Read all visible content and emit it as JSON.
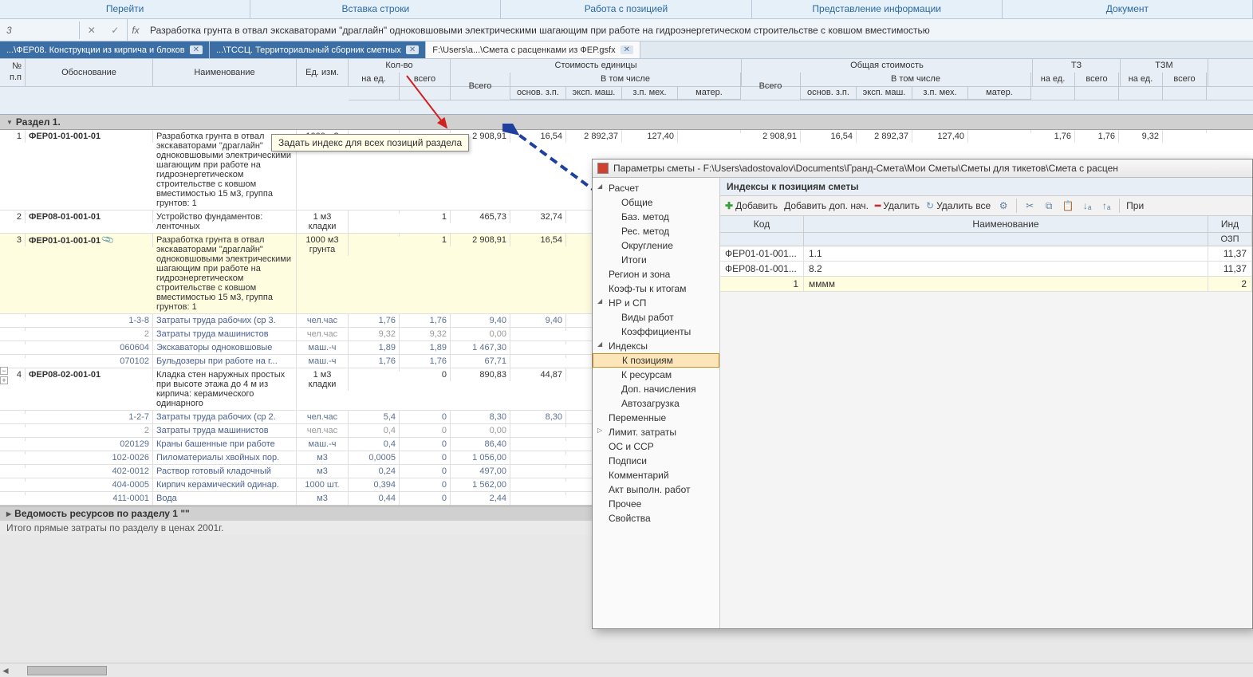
{
  "menu": {
    "items": [
      "Перейти",
      "Вставка строки",
      "Работа с позицией",
      "Представление информации",
      "Документ"
    ]
  },
  "formula_bar": {
    "cell_ref": "3",
    "fx_label": "fx",
    "text": "Разработка грунта в отвал экскаваторами \"драглайн\" одноковшовыми электрическими шагающим при работе на гидроэнергетическом строительстве с ковшом вместимостью"
  },
  "tabs": [
    {
      "label": "...\\ФЕР08. Конструкции из кирпича и блоков",
      "active": false
    },
    {
      "label": "...\\ТССЦ. Территориальный сборник сметных",
      "active": false
    },
    {
      "label": "F:\\Users\\а...\\Смета с расценками из ФЕР.gsfx",
      "active": true
    }
  ],
  "grid_headers": {
    "r1": {
      "pp": "№\nп.п",
      "osn": "Обоснование",
      "name": "Наименование",
      "ed": "Ед. изм.",
      "kol": "Кол-во",
      "se": "Стоимость единицы",
      "os": "Общая стоимость",
      "tz": "ТЗ",
      "tzm": "ТЗМ"
    },
    "r2": {
      "q1": "на ед.",
      "q2": "всего",
      "v1": "Всего",
      "vt": "В том числе",
      "vsego2": "Всего",
      "vt2": "В том числе",
      "ned": "на ед.",
      "vseg": "всего",
      "ned2": "на ед.",
      "vseg2": "всего"
    },
    "r3": {
      "ozp": "основ. з.п.",
      "em": "эксп. маш.",
      "zpm": "з.п. мех.",
      "mat": "матер.",
      "ozp2": "основ. з.п.",
      "em2": "эксп. маш.",
      "zpm2": "з.п. мех.",
      "mat2": "матер."
    }
  },
  "section_header": "Раздел 1.",
  "tooltip": "Задать индекс для всех позиций раздела",
  "rows": [
    {
      "type": "main",
      "pp": "1",
      "osn": "ФЕР01-01-001-01",
      "name": "Разработка грунта в отвал экскаваторами \"драглайн\" одноковшовыми электрическими шагающим при работе на гидроэнергетическом строительстве с ковшом вместимостью 15 м3, группа грунтов: 1",
      "ed": "1000 м3",
      "q1": "",
      "q2": "",
      "vsego": "2 908,91",
      "ozp": "16,54",
      "em": "2 892,37",
      "zpm": "127,40",
      "mat": "",
      "vsego2": "2 908,91",
      "ozp2": "16,54",
      "em2": "2 892,37",
      "zpm2": "127,40",
      "mat2": "",
      "tz1": "1,76",
      "tz2": "1,76",
      "tzm1": "9,32",
      "tzm2": ""
    },
    {
      "type": "main",
      "pp": "2",
      "osn": "ФЕР08-01-001-01",
      "name": "Устройство фундаментов: ленточных",
      "ed": "1 м3 кладки",
      "q1": "",
      "q2": "1",
      "vsego": "465,73",
      "ozp": "32,74",
      "em": "",
      "zpm": "",
      "mat": "",
      "vsego2": "",
      "ozp2": "",
      "em2": "",
      "zpm2": "",
      "mat2": "",
      "tz1": "",
      "tz2": "",
      "tzm1": "",
      "tzm2": ""
    },
    {
      "type": "main",
      "hl": true,
      "pp": "3",
      "osn": "ФЕР01-01-001-01",
      "clip": true,
      "name": "Разработка грунта в отвал экскаваторами \"драглайн\" одноковшовыми электрическими шагающим при работе на гидроэнергетическом строительстве с ковшом вместимостью 15 м3, группа грунтов: 1",
      "ed": "1000 м3 грунта",
      "q1": "",
      "q2": "1",
      "vsego": "2 908,91",
      "ozp": "16,54",
      "em": "",
      "zpm": "",
      "mat": "",
      "vsego2": "",
      "ozp2": "",
      "em2": "",
      "zpm2": "",
      "mat2": "",
      "tz1": "",
      "tz2": "",
      "tzm1": "",
      "tzm2": ""
    },
    {
      "type": "sub",
      "osn": "1-3-8",
      "name": "Затраты труда рабочих (ср 3.",
      "ed": "чел.час",
      "q1": "1,76",
      "q2": "1,76",
      "vsego": "9,40",
      "ozp": "9,40"
    },
    {
      "type": "sub",
      "grey": true,
      "osn": "2",
      "name": "Затраты труда машинистов",
      "ed": "чел.час",
      "q1": "9,32",
      "q2": "9,32",
      "vsego": "0,00",
      "ozp": ""
    },
    {
      "type": "sub",
      "osn": "060604",
      "name": "Экскаваторы одноковшовые ",
      "ed": "маш.-ч",
      "q1": "1,89",
      "q2": "1,89",
      "vsego": "1 467,30",
      "ozp": ""
    },
    {
      "type": "sub",
      "osn": "070102",
      "name": "Бульдозеры при работе на г...",
      "ed": "маш.-ч",
      "q1": "1,76",
      "q2": "1,76",
      "vsego": "67,71",
      "ozp": ""
    },
    {
      "type": "main",
      "pp": "4",
      "osn": "ФЕР08-02-001-01",
      "name": "Кладка стен наружных простых при высоте этажа до 4 м из кирпича: керамического одинарного",
      "ed": "1 м3 кладки",
      "q1": "",
      "q2": "0",
      "vsego": "890,83",
      "ozp": "44,87",
      "em": "",
      "zpm": "",
      "mat": "",
      "vsego2": "",
      "ozp2": "",
      "em2": "",
      "zpm2": "",
      "mat2": "",
      "tz1": "",
      "tz2": "",
      "tzm1": "",
      "tzm2": ""
    },
    {
      "type": "sub",
      "osn": "1-2-7",
      "name": "Затраты труда рабочих (ср 2.",
      "ed": "чел.час",
      "q1": "5,4",
      "q2": "0",
      "vsego": "8,30",
      "ozp": "8,30"
    },
    {
      "type": "sub",
      "grey": true,
      "osn": "2",
      "name": "Затраты труда машинистов",
      "ed": "чел.час",
      "q1": "0,4",
      "q2": "0",
      "vsego": "0,00",
      "ozp": ""
    },
    {
      "type": "sub",
      "osn": "020129",
      "name": "Краны башенные при работе",
      "ed": "маш.-ч",
      "q1": "0,4",
      "q2": "0",
      "vsego": "86,40",
      "ozp": ""
    },
    {
      "type": "sub",
      "osn": "102-0026",
      "name": "Пиломатериалы хвойных пор.",
      "ed": "м3",
      "q1": "0,0005",
      "q2": "0",
      "vsego": "1 056,00",
      "ozp": ""
    },
    {
      "type": "sub",
      "osn": "402-0012",
      "name": "Раствор готовый кладочный ",
      "ed": "м3",
      "q1": "0,24",
      "q2": "0",
      "vsego": "497,00",
      "ozp": ""
    },
    {
      "type": "sub",
      "osn": "404-0005",
      "name": "Кирпич керамический одинар.",
      "ed": "1000 шт.",
      "q1": "0,394",
      "q2": "0",
      "vsego": "1 562,00",
      "ozp": ""
    },
    {
      "type": "sub",
      "osn": "411-0001",
      "name": "Вода",
      "ed": "м3",
      "q1": "0,44",
      "q2": "0",
      "vsego": "2,44",
      "ozp": ""
    }
  ],
  "footer_section": "Ведомость ресурсов по разделу 1 \"\"",
  "totals_text": "Итого прямые затраты по разделу в ценах 2001г.",
  "float_win": {
    "title": "Параметры сметы - F:\\Users\\adostovalov\\Documents\\Гранд-Смета\\Мои Сметы\\Сметы для тикетов\\Смета с расцен",
    "tree": [
      {
        "label": "Расчет",
        "toggle": true,
        "l": 1
      },
      {
        "label": "Общие",
        "l": 2
      },
      {
        "label": "Баз. метод",
        "l": 2
      },
      {
        "label": "Рес. метод",
        "l": 2
      },
      {
        "label": "Округление",
        "l": 2
      },
      {
        "label": "Итоги",
        "l": 2
      },
      {
        "label": "Регион и зона",
        "l": 1
      },
      {
        "label": "Коэф-ты к итогам",
        "l": 1
      },
      {
        "label": "НР и СП",
        "toggle": true,
        "l": 1
      },
      {
        "label": "Виды работ",
        "l": 2
      },
      {
        "label": "Коэффициенты",
        "l": 2
      },
      {
        "label": "Индексы",
        "toggle": true,
        "l": 1
      },
      {
        "label": "К позициям",
        "l": 2,
        "selected": true
      },
      {
        "label": "К ресурсам",
        "l": 2
      },
      {
        "label": "Доп. начисления",
        "l": 2
      },
      {
        "label": "Автозагрузка",
        "l": 2
      },
      {
        "label": "Переменные",
        "l": 1
      },
      {
        "label": "Лимит. затраты",
        "toggle": true,
        "collapsed": true,
        "l": 1
      },
      {
        "label": "ОС и ССР",
        "l": 1
      },
      {
        "label": "Подписи",
        "l": 1
      },
      {
        "label": "Комментарий",
        "l": 1
      },
      {
        "label": "Акт выполн. работ",
        "l": 1
      },
      {
        "label": "Прочее",
        "l": 1
      },
      {
        "label": "Свойства",
        "l": 1
      }
    ],
    "panel_title": "Индексы к позициям сметы",
    "toolbar": {
      "add": "Добавить",
      "add_dop": "Добавить доп. нач.",
      "delete": "Удалить",
      "delete_all": "Удалить все",
      "apply": "При"
    },
    "grid_header": {
      "code": "Код",
      "name": "Наименование",
      "idx": "Инд",
      "ozp": "ОЗП"
    },
    "rows": [
      {
        "code": "ФЕР01-01-001...",
        "name": "1.1",
        "ozp": "11,37"
      },
      {
        "code": "ФЕР08-01-001...",
        "name": "8.2",
        "ozp": "11,37"
      },
      {
        "code": "1",
        "name": "мммм",
        "ozp": "2",
        "edit": true
      }
    ]
  }
}
